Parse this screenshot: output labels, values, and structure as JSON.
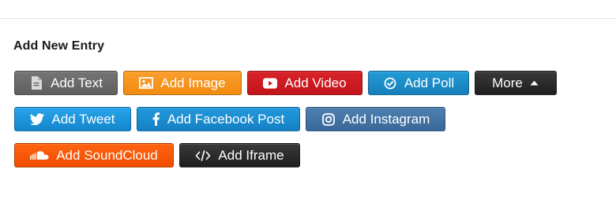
{
  "section": {
    "title": "Add New Entry"
  },
  "buttons": {
    "add_text": {
      "label": "Add Text",
      "icon": "document-icon",
      "color": "#686868"
    },
    "add_image": {
      "label": "Add Image",
      "icon": "image-icon",
      "color": "#f7941d"
    },
    "add_video": {
      "label": "Add Video",
      "icon": "youtube-play-icon",
      "color": "#cc181e"
    },
    "add_poll": {
      "label": "Add Poll",
      "icon": "check-circle-icon",
      "color": "#1a8fc9"
    },
    "more": {
      "label": "More",
      "icon": "caret-up-icon",
      "color": "#2a2a2a"
    },
    "add_tweet": {
      "label": "Add Tweet",
      "icon": "twitter-icon",
      "color": "#1b95e0"
    },
    "add_facebook_post": {
      "label": "Add Facebook Post",
      "icon": "facebook-icon",
      "color": "#1b8fd2"
    },
    "add_instagram": {
      "label": "Add Instagram",
      "icon": "instagram-icon",
      "color": "#4375a5"
    },
    "add_soundcloud": {
      "label": "Add SoundCloud",
      "icon": "soundcloud-icon",
      "color": "#ff5500"
    },
    "add_iframe": {
      "label": "Add Iframe",
      "icon": "code-icon",
      "color": "#2a2a2a"
    }
  }
}
